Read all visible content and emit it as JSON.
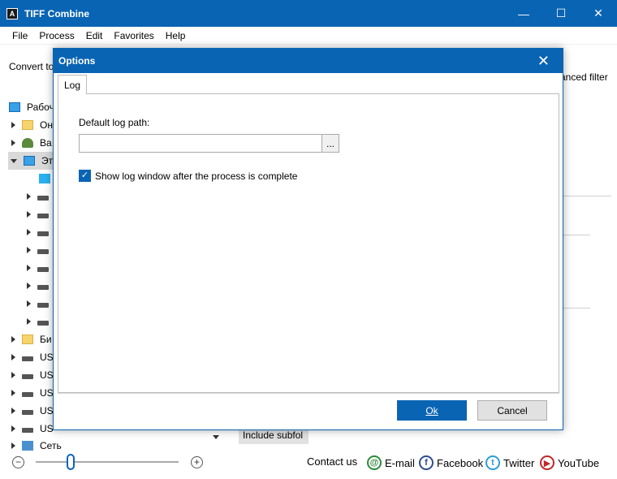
{
  "app": {
    "title": "TIFF Combine",
    "icon_letter": "A",
    "controls": {
      "minimize": "—",
      "maximize": "☐",
      "close": "✕"
    }
  },
  "menu": [
    "File",
    "Process",
    "Edit",
    "Favorites",
    "Help"
  ],
  "main": {
    "convert_label": "Convert to",
    "advanced_filter": "anced filter",
    "include_subfolders": "Include subfol"
  },
  "tree": [
    {
      "label": "Рабоч",
      "icon": "desktop-icon"
    },
    {
      "label": "Он",
      "icon": "folder-icon"
    },
    {
      "label": "Ва",
      "icon": "user-icon"
    },
    {
      "label": "Эт",
      "icon": "computer-icon"
    },
    {
      "label": "",
      "icon": "3d-objects-icon"
    },
    {
      "label": "",
      "icon": "windows-drive-icon"
    },
    {
      "label": "",
      "icon": "drive-icon"
    },
    {
      "label": "",
      "icon": "drive-icon"
    },
    {
      "label": "",
      "icon": "drive-icon"
    },
    {
      "label": "",
      "icon": "drive-icon"
    },
    {
      "label": "",
      "icon": "drive-icon"
    },
    {
      "label": "",
      "icon": "drive-icon"
    },
    {
      "label": "",
      "icon": "cd-drive-icon"
    },
    {
      "label": "Би",
      "icon": "library-icon"
    },
    {
      "label": "US",
      "icon": "usb-drive-icon"
    },
    {
      "label": "US",
      "icon": "usb-drive-icon"
    },
    {
      "label": "US",
      "icon": "usb-drive-icon"
    },
    {
      "label": "US",
      "icon": "usb-drive-icon"
    },
    {
      "label": "US",
      "icon": "usb-drive-icon"
    },
    {
      "label": "Сеть",
      "icon": "network-icon"
    }
  ],
  "status": {
    "zoom_minus": "−",
    "zoom_plus": "+",
    "contact": "Contact us",
    "email": "E-mail",
    "facebook": "Facebook",
    "twitter": "Twitter",
    "youtube": "YouTube",
    "email_glyph": "@",
    "facebook_glyph": "f",
    "twitter_glyph": "t",
    "youtube_glyph": "▶"
  },
  "dialog": {
    "title": "Options",
    "close": "✕",
    "tab": "Log",
    "default_log_path_label": "Default log path:",
    "default_log_path_value": "",
    "browse": "...",
    "show_log_checked": true,
    "show_log_label": "Show log window after the process is complete",
    "check_glyph": "✓",
    "ok": "Ok",
    "cancel": "Cancel"
  }
}
